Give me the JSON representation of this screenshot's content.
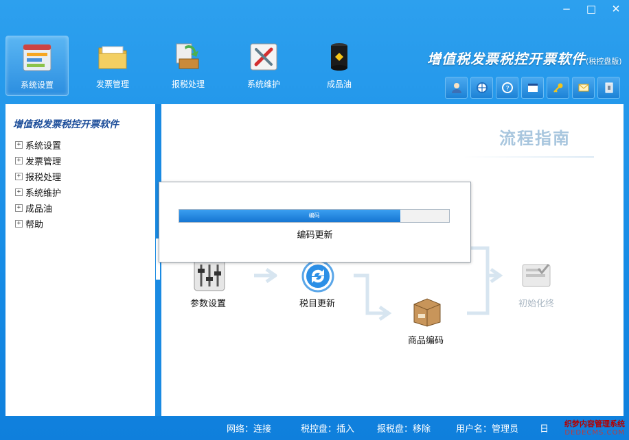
{
  "window": {
    "controls": [
      "−",
      "□",
      "✕"
    ]
  },
  "toolbar": {
    "items": [
      {
        "label": "系统设置",
        "icon": "settings-panel-icon",
        "active": true
      },
      {
        "label": "发票管理",
        "icon": "folder-icon",
        "active": false
      },
      {
        "label": "报税处理",
        "icon": "tax-report-icon",
        "active": false
      },
      {
        "label": "系统维护",
        "icon": "maintenance-tools-icon",
        "active": false
      },
      {
        "label": "成品油",
        "icon": "oil-barrel-icon",
        "active": false
      }
    ]
  },
  "brand": {
    "title": "增值税发票税控开票软件",
    "subtitle": "(税控盘版)"
  },
  "quickbar": {
    "icons": [
      "user-icon",
      "globe-icon",
      "help-icon",
      "window-icon",
      "key-icon",
      "mail-icon",
      "exit-icon"
    ]
  },
  "sidebar": {
    "title": "增值税发票税控开票软件",
    "items": [
      {
        "label": "系统设置"
      },
      {
        "label": "发票管理"
      },
      {
        "label": "报税处理"
      },
      {
        "label": "系统维护"
      },
      {
        "label": "成品油"
      },
      {
        "label": "帮助"
      }
    ],
    "expander": "+"
  },
  "main": {
    "guide_title": "流程指南",
    "flow": {
      "nodes": [
        {
          "label": "参数设置",
          "icon": "sliders-icon"
        },
        {
          "label": "税目更新",
          "icon": "refresh-icon"
        },
        {
          "label": "商品编码",
          "icon": "package-box-icon"
        },
        {
          "label": "初始化终",
          "icon": "init-terminal-icon"
        }
      ]
    }
  },
  "dialog": {
    "progress_text": "编码",
    "progress": 0.82,
    "message": "编码更新"
  },
  "statusbar": {
    "items": [
      "网络：连接",
      "税控盘：插入",
      "报税盘：移除",
      "用户名：管理员",
      "日"
    ]
  },
  "watermark": {
    "line1": "织梦内容管理系统",
    "line2": "DEDECMS.COM"
  },
  "colors": {
    "chrome_blue": "#168ce6",
    "sidebar_title": "#1d4e9a",
    "guide_title": "#a8c6de",
    "progress_fill": "#1676d2",
    "watermark": "#b30000"
  }
}
